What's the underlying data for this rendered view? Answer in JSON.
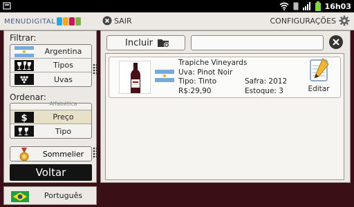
{
  "status_bar": {
    "time": "16h03"
  },
  "header": {
    "logo_text": "MENUDIGITAL",
    "logo_cup_colors": [
      "#29a7e1",
      "#f5a623",
      "#c2185b",
      "#7cb342"
    ],
    "exit_label": "SAIR",
    "settings_label": "CONFIGURAÇÕES"
  },
  "filter": {
    "title": "Filtrar:",
    "items": [
      {
        "label": "Argentina",
        "icon": "argentina-flag-icon"
      },
      {
        "label": "Tipos",
        "icon": "wine-glasses-icon"
      },
      {
        "label": "Uvas",
        "icon": "grapes-icon"
      }
    ]
  },
  "order": {
    "title": "Ordenar:",
    "items": [
      {
        "label": "Alfabética",
        "icon": "alphabet-icon"
      },
      {
        "label": "Preço",
        "icon": "dollar-icon",
        "selected": true
      },
      {
        "label": "Tipo",
        "icon": "wine-glasses-icon"
      }
    ]
  },
  "sommelier_label": "Sommelier",
  "back_label": "Voltar",
  "language_label": "Português",
  "toolbar": {
    "add_label": "Incluir",
    "search_value": ""
  },
  "wines": [
    {
      "name": "Trapiche Vineyards",
      "grape": "Uva:   Pinot Noir",
      "type": "Tipo: Tinto",
      "price": "R$:29,90",
      "vintage": "Safra: 2012",
      "stock": "Estoque: 3",
      "edit_label": "Editar"
    }
  ],
  "colors": {
    "background": "#3a0f16",
    "panel": "#ece9e4",
    "selected": "#e6e1c7"
  }
}
